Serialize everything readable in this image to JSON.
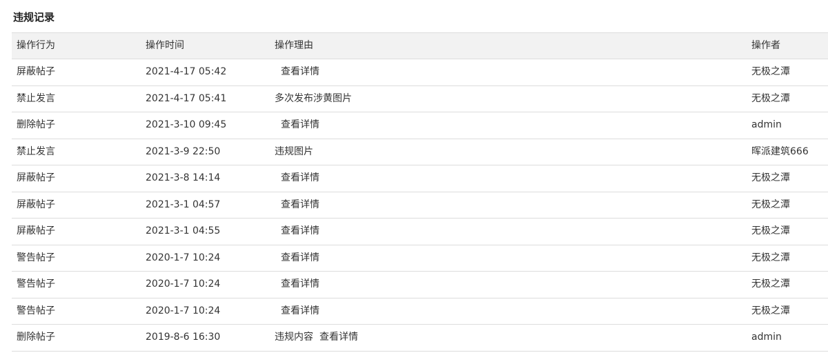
{
  "page_title": "违规记录",
  "columns": {
    "action": "操作行为",
    "time": "操作时间",
    "reason": "操作理由",
    "operator": "操作者"
  },
  "rows": [
    {
      "action": "屏蔽帖子",
      "time": "2021-4-17 05:42",
      "reason": "",
      "link": "查看详情",
      "operator": "无极之潭"
    },
    {
      "action": "禁止发言",
      "time": "2021-4-17 05:41",
      "reason": "多次发布涉黄图片",
      "link": "",
      "operator": "无极之潭"
    },
    {
      "action": "删除帖子",
      "time": "2021-3-10 09:45",
      "reason": "",
      "link": "查看详情",
      "operator": "admin"
    },
    {
      "action": "禁止发言",
      "time": "2021-3-9 22:50",
      "reason": "违规图片",
      "link": "",
      "operator": "晖派建筑666"
    },
    {
      "action": "屏蔽帖子",
      "time": "2021-3-8 14:14",
      "reason": "",
      "link": "查看详情",
      "operator": "无极之潭"
    },
    {
      "action": "屏蔽帖子",
      "time": "2021-3-1 04:57",
      "reason": "",
      "link": "查看详情",
      "operator": "无极之潭"
    },
    {
      "action": "屏蔽帖子",
      "time": "2021-3-1 04:55",
      "reason": "",
      "link": "查看详情",
      "operator": "无极之潭"
    },
    {
      "action": "警告帖子",
      "time": "2020-1-7 10:24",
      "reason": "",
      "link": "查看详情",
      "operator": "无极之潭"
    },
    {
      "action": "警告帖子",
      "time": "2020-1-7 10:24",
      "reason": "",
      "link": "查看详情",
      "operator": "无极之潭"
    },
    {
      "action": "警告帖子",
      "time": "2020-1-7 10:24",
      "reason": "",
      "link": "查看详情",
      "operator": "无极之潭"
    },
    {
      "action": "删除帖子",
      "time": "2019-8-6 16:30",
      "reason": "违规内容",
      "link": "查看详情",
      "operator": "admin"
    }
  ]
}
